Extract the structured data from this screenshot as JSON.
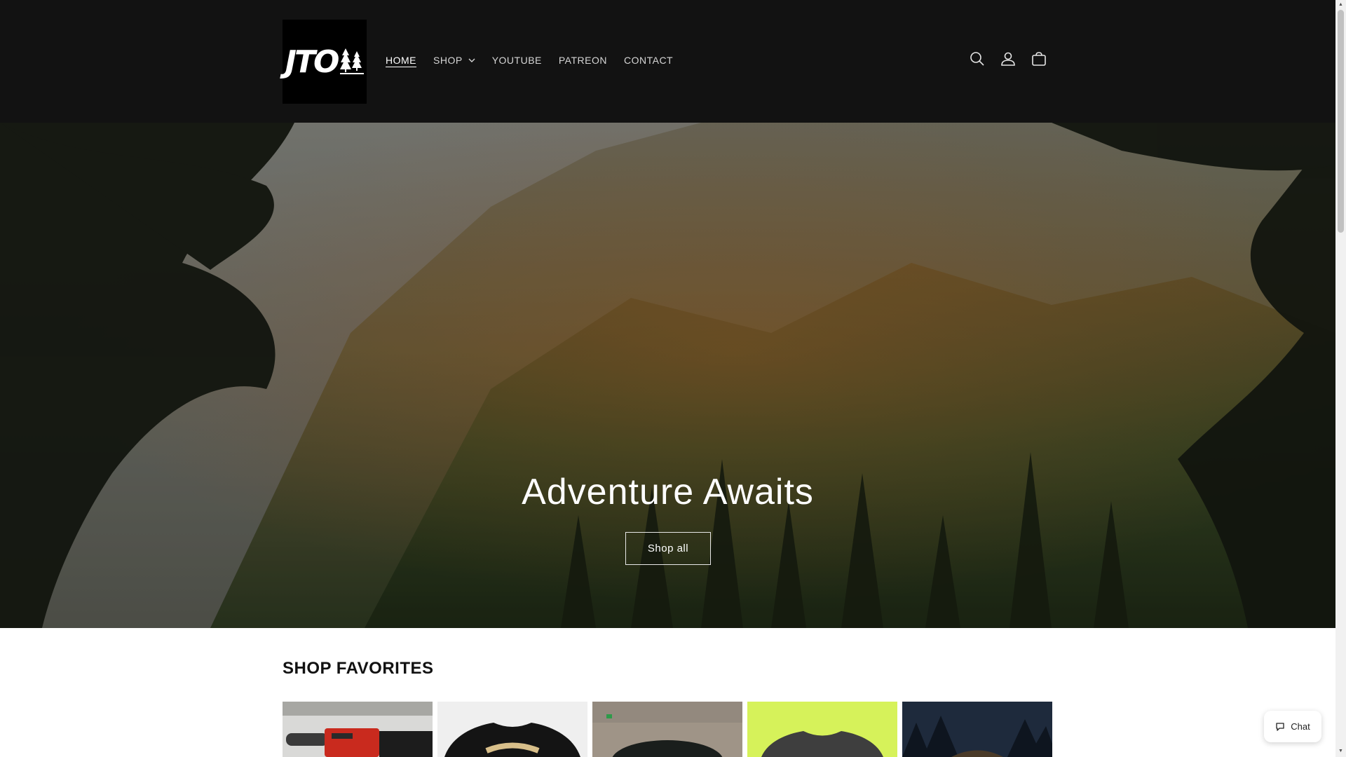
{
  "header": {
    "logo_text": "JTO",
    "nav": [
      {
        "label": "HOME"
      },
      {
        "label": "SHOP"
      },
      {
        "label": "YOUTUBE"
      },
      {
        "label": "PATREON"
      },
      {
        "label": "CONTACT"
      }
    ],
    "icons": [
      "search-icon",
      "account-icon",
      "cart-icon"
    ]
  },
  "hero": {
    "title": "Adventure Awaits",
    "button_label": "Shop all"
  },
  "favorites": {
    "title": "SHOP FAVORITES",
    "product_count": 5
  },
  "chat": {
    "label": "Chat"
  },
  "colors": {
    "header_bg": "#121212",
    "text_light": "#ffffff",
    "page_bg": "#ffffff"
  }
}
